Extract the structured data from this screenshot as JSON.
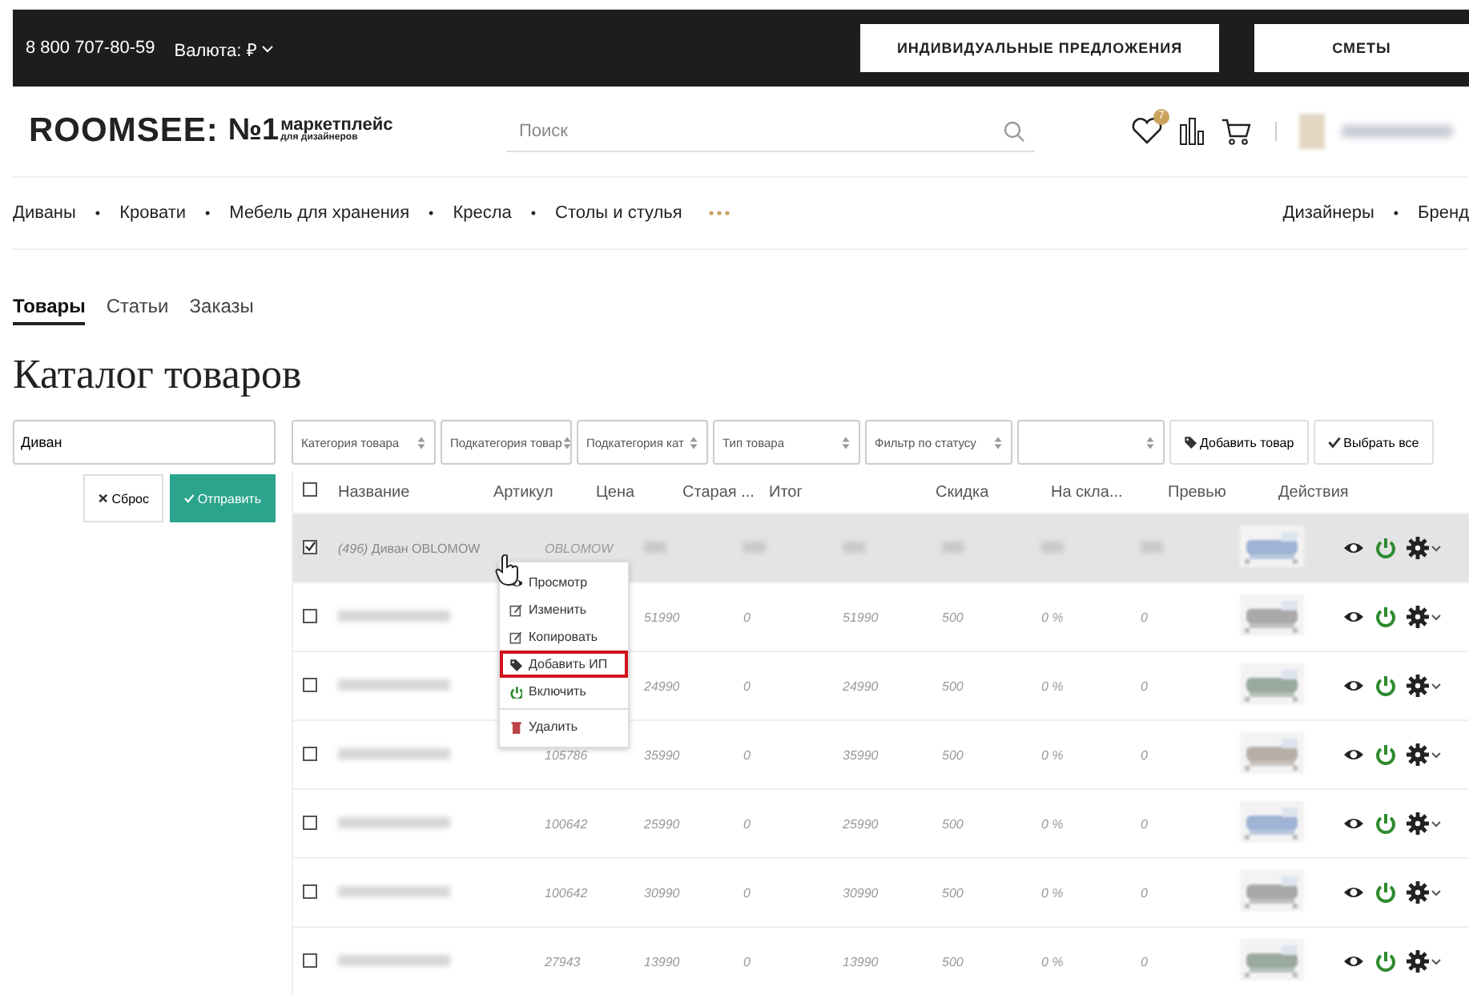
{
  "top_bar": {
    "phone": "8 800 707-80-59",
    "currency": "Валюта: ₽",
    "buttons": [
      "ИНДИВИДУАЛЬНЫЕ ПРЕДЛОЖЕНИЯ",
      "СМЕТЫ"
    ]
  },
  "header": {
    "logo": "ROOMSEE:",
    "logo_badge": "№1",
    "logo_tagline": "маркетплейс",
    "logo_subtitle": "для дизайнеров",
    "search": {
      "placeholder": "Поиск"
    },
    "favorites_count": "7"
  },
  "nav": {
    "separator": "•",
    "categories": [
      "Диваны",
      "Кровати",
      "Мебель для хранения",
      "Кресла",
      "Столы и стулья"
    ],
    "right_links": [
      "Дизайнеры",
      "Бренд"
    ]
  },
  "tabs": [
    {
      "label": "Товары",
      "selected": true
    },
    {
      "label": "Статьи",
      "selected": false
    },
    {
      "label": "Заказы",
      "selected": false
    }
  ],
  "title": "Каталог товаров",
  "search_field": {
    "value": "Диван"
  },
  "form_buttons": [
    {
      "kind": "reset",
      "label": "Сброс"
    },
    {
      "kind": "submit",
      "label": "Отправить"
    }
  ],
  "filters": [
    {
      "kind": "select",
      "label": "Категория товара"
    },
    {
      "kind": "select",
      "label": "Подкатегория товар"
    },
    {
      "kind": "select",
      "label": "Подкатегория кат"
    },
    {
      "kind": "select",
      "label": "Тип товара"
    },
    {
      "kind": "select",
      "label": "Фильтр по статусу"
    },
    {
      "kind": "select"
    }
  ],
  "toolbar_buttons": [
    {
      "kind": "tag",
      "label": "Добавить товар"
    },
    {
      "kind": "check",
      "label": "Выбрать все"
    }
  ],
  "table": {
    "all_checked": false,
    "columns": [
      {
        "kind": "text",
        "label": "Название"
      },
      {
        "kind": "text",
        "label": "Артикул"
      },
      {
        "kind": "text",
        "label": "Цена"
      },
      {
        "kind": "text",
        "label": "Старая ..."
      },
      {
        "kind": "text",
        "label": "Итог"
      },
      {
        "kind": "text"
      },
      {
        "kind": "text",
        "label": "Скидка"
      },
      {
        "kind": "text",
        "label": "На скла..."
      },
      {
        "kind": "picture",
        "label": "Превью"
      },
      {
        "kind": "actions",
        "label": "Действия"
      }
    ],
    "rows": [
      {
        "checked": true,
        "selected": true,
        "name_blurred": false,
        "values_blurred": true,
        "name": "*(496)* Диван OBLOMOW",
        "article": "OBLOMOW"
      },
      {
        "checked": false,
        "selected": false,
        "name_blurred": true,
        "values_blurred": false,
        "price": "51990",
        "old_price": "0",
        "total": "51990",
        "column_6": "500",
        "discount": "0 %",
        "stock": "0"
      },
      {
        "checked": false,
        "selected": false,
        "name_blurred": true,
        "values_blurred": false,
        "price": "24990",
        "old_price": "0",
        "total": "24990",
        "column_6": "500",
        "discount": "0 %",
        "stock": "0"
      },
      {
        "checked": false,
        "selected": false,
        "name_blurred": true,
        "values_blurred": false,
        "article": "105786",
        "price": "35990",
        "old_price": "0",
        "total": "35990",
        "column_6": "500",
        "discount": "0 %",
        "stock": "0"
      },
      {
        "checked": false,
        "selected": false,
        "name_blurred": true,
        "values_blurred": false,
        "article": "100642",
        "price": "25990",
        "old_price": "0",
        "total": "25990",
        "column_6": "500",
        "discount": "0 %",
        "stock": "0"
      },
      {
        "checked": false,
        "selected": false,
        "name_blurred": true,
        "values_blurred": false,
        "article": "100642",
        "price": "30990",
        "old_price": "0",
        "total": "30990",
        "column_6": "500",
        "discount": "0 %",
        "stock": "0"
      },
      {
        "checked": false,
        "selected": false,
        "name_blurred": true,
        "values_blurred": false,
        "article": "27943",
        "price": "13990",
        "old_price": "0",
        "total": "13990",
        "column_6": "500",
        "discount": "0 %",
        "stock": "0"
      }
    ]
  },
  "context_menu": {
    "items": [
      {
        "kind": "view",
        "label": "Просмотр",
        "selected": false
      },
      {
        "kind": "edit",
        "label": "Изменить",
        "selected": false
      },
      {
        "kind": "copy",
        "label": "Копировать",
        "selected": false
      },
      {
        "kind": "tag",
        "label": "Добавить ИП",
        "selected": true
      },
      {
        "kind": "power",
        "label": "Включить",
        "selected": false
      },
      {
        "kind": "delete",
        "label": "Удалить",
        "selected": false
      }
    ]
  }
}
